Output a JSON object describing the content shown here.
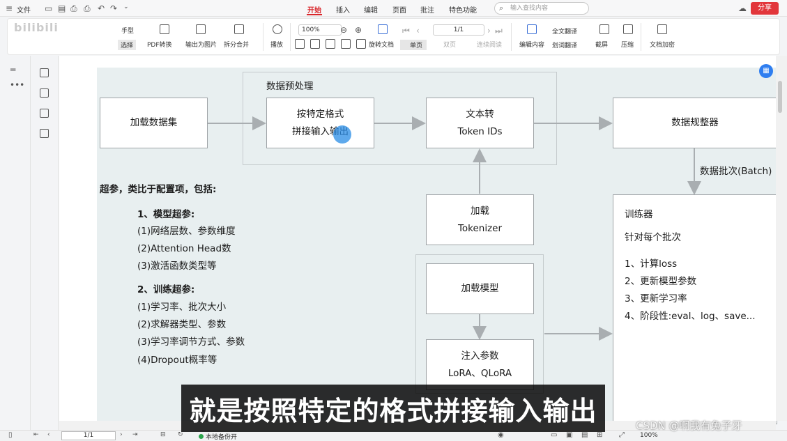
{
  "menubar": {
    "file_label": "文件",
    "tabs": [
      {
        "label": "开始",
        "active": true
      },
      {
        "label": "插入"
      },
      {
        "label": "编辑"
      },
      {
        "label": "页面"
      },
      {
        "label": "批注"
      },
      {
        "label": "特色功能"
      }
    ],
    "search_placeholder": "输入查找内容",
    "share_label": "分享"
  },
  "ribbon": {
    "hand_label": "手型",
    "select_label": "选择",
    "pdf_convert": "PDF转换",
    "export_image": "输出为图片",
    "split_merge": "拆分合并",
    "play": "播放",
    "zoom": "100%",
    "page_indicator": "1/1",
    "rotate_doc": "旋转文档",
    "single_page": "单页",
    "double_page": "双页",
    "continuous": "连续阅读",
    "edit_content": "编辑内容",
    "full_translate": "全文翻译",
    "word_translate": "划词翻译",
    "screenshot": "截屏",
    "compress": "压缩",
    "doc_encrypt": "文档加密"
  },
  "ghost_logo": "bilibili",
  "diagram": {
    "group_title": "数据预处理",
    "load_dataset": "加载数据集",
    "format_line1": "按特定格式",
    "format_line2": "拼接输入输出",
    "text_line1": "文本转",
    "text_line2": "Token IDs",
    "data_normalizer": "数据规整器",
    "batch_label": "数据批次(Batch)",
    "tokenizer_line1": "加载",
    "tokenizer_line2": "Tokenizer",
    "load_model": "加载模型",
    "inject_line1": "注入参数",
    "inject_line2": "LoRA、QLoRA",
    "trainer": {
      "title": "训练器",
      "subtitle": "针对每个批次",
      "steps": [
        "1、计算loss",
        "2、更新模型参数",
        "3、更新学习率",
        "4、阶段性:eval、log、save..."
      ]
    },
    "hyperparams": {
      "heading": "超参，类比于配置项，包括:",
      "model_heading": "1、模型超参:",
      "model_items": [
        "(1)网络层数、参数维度",
        "(2)Attention Head数",
        "(3)激活函数类型等"
      ],
      "train_heading": "2、训练超参:",
      "train_items": [
        "(1)学习率、批次大小",
        "(2)求解器类型、参数",
        "(3)学习率调节方式、参数",
        "(4)Dropout概率等"
      ]
    }
  },
  "subtitle": "就是按照特定的格式拼接输入输出",
  "watermark": "CSDN @啊我有兔子牙",
  "statusbar": {
    "page": "1/1",
    "save_status": "本地备份开",
    "zoom": "100%"
  },
  "colors": {
    "accent": "#d9262b",
    "canvas": "#e8eff0",
    "cursor": "#288ce6"
  },
  "icons": [
    "file-icon",
    "save-icon",
    "print-icon",
    "undo-icon",
    "redo-icon",
    "search-icon",
    "share-icon",
    "bookmark-icon",
    "thumbnail-icon",
    "comment-icon",
    "attachment-icon"
  ]
}
